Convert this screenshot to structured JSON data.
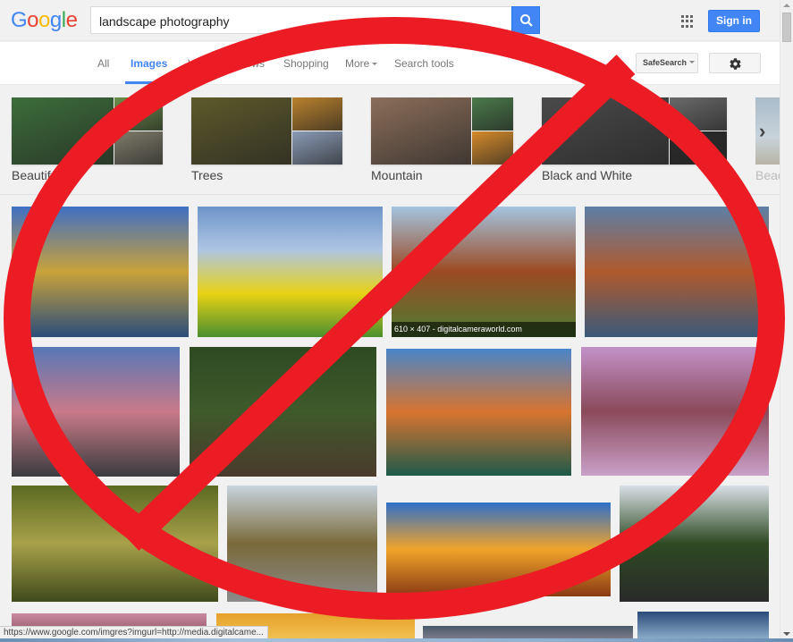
{
  "header": {
    "logo": {
      "letters": [
        "G",
        "o",
        "o",
        "g",
        "l",
        "e"
      ],
      "colors": [
        "#4285f4",
        "#ea4335",
        "#fbbc05",
        "#4285f4",
        "#34a853",
        "#ea4335"
      ]
    },
    "search_query": "landscape photography",
    "search_button_icon": "search-icon",
    "apps_icon": "apps-grid-icon",
    "sign_in_label": "Sign in"
  },
  "nav": {
    "items": [
      {
        "label": "All",
        "active": false
      },
      {
        "label": "Images",
        "active": true
      },
      {
        "label": "Videos",
        "active": false
      },
      {
        "label": "News",
        "active": false
      },
      {
        "label": "Shopping",
        "active": false
      },
      {
        "label": "More",
        "active": false,
        "dropdown": true
      },
      {
        "label": "Search tools",
        "active": false
      }
    ],
    "safesearch_label": "SafeSearch",
    "settings_icon": "gear-icon",
    "accent_color": "#4285f4"
  },
  "related_searches": [
    {
      "label": "Beautiful",
      "colors": [
        "#3c6e3a",
        "#6a8f4a",
        "#7f7c6a"
      ]
    },
    {
      "label": "Trees",
      "colors": [
        "#5d5a2a",
        "#b9812c",
        "#8a9bb5"
      ]
    },
    {
      "label": "Mountain",
      "colors": [
        "#8b6e5a",
        "#4a7a4a",
        "#d48a2a"
      ]
    },
    {
      "label": "Black and White",
      "colors": [
        "#4a4a4a",
        "#6a6a6a",
        "#2a2a2a"
      ]
    },
    {
      "label": "Beach",
      "colors": [
        "#a9bccb"
      ]
    }
  ],
  "results": [
    {
      "name": "mountain-lake-reflection",
      "gradient": [
        "#3f6fc4",
        "#c9a23a",
        "#2a4d7a"
      ]
    },
    {
      "name": "tree-yellow-field",
      "gradient": [
        "#6d94c9",
        "#aec5e3",
        "#e8d215",
        "#4b8f2e"
      ]
    },
    {
      "name": "waterfall-cliff",
      "gradient": [
        "#a3c4e0",
        "#9b4a22",
        "#4d7d33"
      ],
      "caption": "610 × 407 - digitalcameraworld.com"
    },
    {
      "name": "rocky-lake-sunset",
      "gradient": [
        "#5d7fa6",
        "#b05a2d",
        "#3a5a7a"
      ]
    },
    {
      "name": "road-pink-clouds",
      "gradient": [
        "#5777b8",
        "#c97a88",
        "#3a3c40"
      ]
    },
    {
      "name": "wooden-bridge-forest",
      "gradient": [
        "#2e4a22",
        "#3f5a2b",
        "#4b3a2c"
      ]
    },
    {
      "name": "canyon-river",
      "gradient": [
        "#4a86c9",
        "#d8742f",
        "#1e5a4a"
      ]
    },
    {
      "name": "purple-lake",
      "gradient": [
        "#c292c8",
        "#8a4a5a",
        "#c9a0c8"
      ]
    },
    {
      "name": "arch-bridge-reflection",
      "gradient": [
        "#5b6a22",
        "#a8a14a",
        "#3f4a1c"
      ]
    },
    {
      "name": "stone-wall-path",
      "gradient": [
        "#c8d4e0",
        "#7a6a3a",
        "#8a8a8a"
      ]
    },
    {
      "name": "tree-sunset",
      "gradient": [
        "#2f6fc9",
        "#f1a42a",
        "#8a3a14"
      ]
    },
    {
      "name": "forest-road",
      "gradient": [
        "#d8dfe6",
        "#2e4a22",
        "#2a2a2a"
      ]
    },
    {
      "name": "pink-sky",
      "gradient": [
        "#c98aa0",
        "#8a4a5a"
      ]
    },
    {
      "name": "orange-sky",
      "gradient": [
        "#e6a02a",
        "#f0c050"
      ]
    },
    {
      "name": "galaxy-sky",
      "gradient": [
        "#4a5a6a",
        "#7a7a8a"
      ]
    },
    {
      "name": "blue-mountains",
      "gradient": [
        "#2a4a7a",
        "#8aaac8"
      ]
    }
  ],
  "status_bar": {
    "url": "https://www.google.com/imgres?imgurl=http://media.digitalcame..."
  },
  "overlay": {
    "symbol": "prohibition-sign",
    "color": "#ec1c24"
  }
}
